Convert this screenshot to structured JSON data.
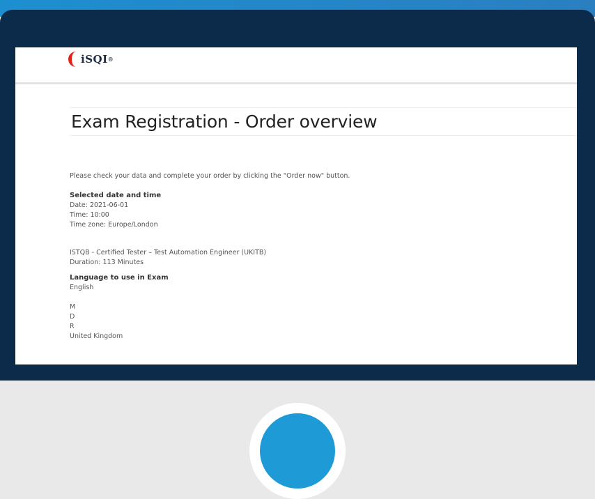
{
  "brand": {
    "logo_text": "iSQI",
    "logo_mark": "®"
  },
  "page": {
    "title": "Exam Registration - Order overview"
  },
  "instruction": "Please check your data and complete your order by clicking the \"Order now\" button.",
  "schedule": {
    "heading": "Selected date and time",
    "date": "Date: 2021-06-01",
    "time": "Time: 10:00",
    "timezone": "Time zone: Europe/London"
  },
  "exam": {
    "name": "ISTQB - Certified Tester – Test Automation Engineer (UKITB)",
    "duration": "Duration: 113 Minutes"
  },
  "language": {
    "heading": "Language to use in Exam",
    "value": "English"
  },
  "address": {
    "line1": "M",
    "line2": "D",
    "line3": "R",
    "country": "United Kingdom"
  },
  "colors": {
    "frame": "#0c2b4a",
    "top_band": "#1d8fd0",
    "logo_red": "#e2231a",
    "circle_blue": "#1e9ad6"
  }
}
